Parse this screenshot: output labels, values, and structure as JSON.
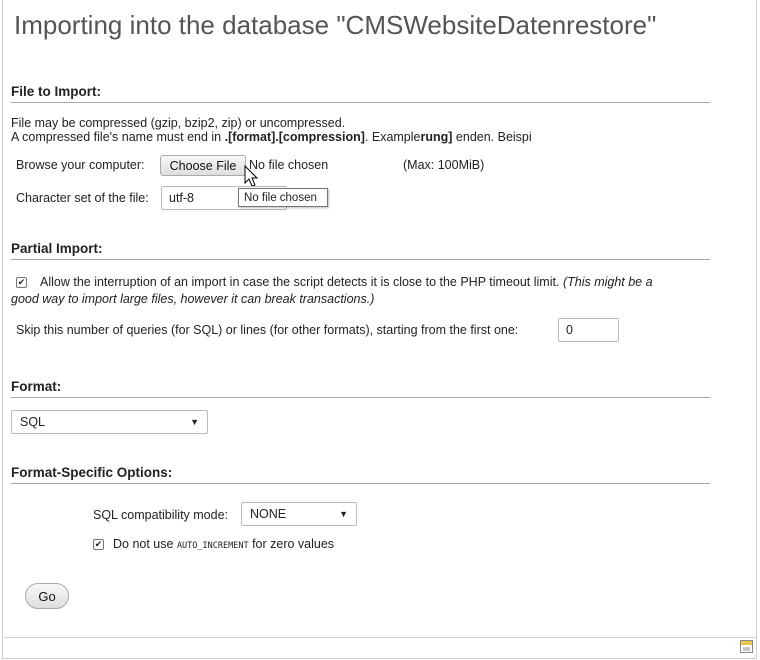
{
  "title": "Importing into the database \"CMSWebsiteDatenrestore\"",
  "file_section": {
    "title": "File to Import:",
    "desc_line1": "File may be compressed (gzip, bzip2, zip) or uncompressed.",
    "desc_line2_pre": "A compressed file's name must end in ",
    "desc_line2_bold1": ".[format].[compression]",
    "desc_line2_mid": ". Exampl",
    "desc_line2_mid2": "e",
    "desc_line2_bold2": "rung]",
    "desc_line2_post": " enden. Beispi",
    "browse_label": "Browse your computer:",
    "choose_file_button": "Choose File",
    "no_file_text": "No file chosen",
    "max_text": "(Max: 100MiB)",
    "tooltip_text": "No file chosen",
    "charset_label": "Character set of the file:",
    "charset_value": "utf-8"
  },
  "partial_section": {
    "title": "Partial Import:",
    "allow_label": "Allow the interruption of an import in case the script detects it is close to the PHP timeout limit.",
    "allow_note_line1": "(This might be a",
    "allow_note_line2": "good way to import large files, however it can break transactions.)",
    "allow_checked": true,
    "skip_label": "Skip this number of queries (for SQL) or lines (for other formats), starting from the first one:",
    "skip_value": "0"
  },
  "format_section": {
    "title": "Format:",
    "selected": "SQL"
  },
  "options_section": {
    "title": "Format-Specific Options:",
    "compat_label": "SQL compatibility mode:",
    "compat_value": "NONE",
    "autoinc_pre": "Do not use ",
    "autoinc_code": "AUTO_INCREMENT",
    "autoinc_post": " for zero values",
    "autoinc_checked": true
  },
  "go_button": "Go",
  "icons": {
    "checkmark": "✔",
    "dropdown": "▼"
  }
}
